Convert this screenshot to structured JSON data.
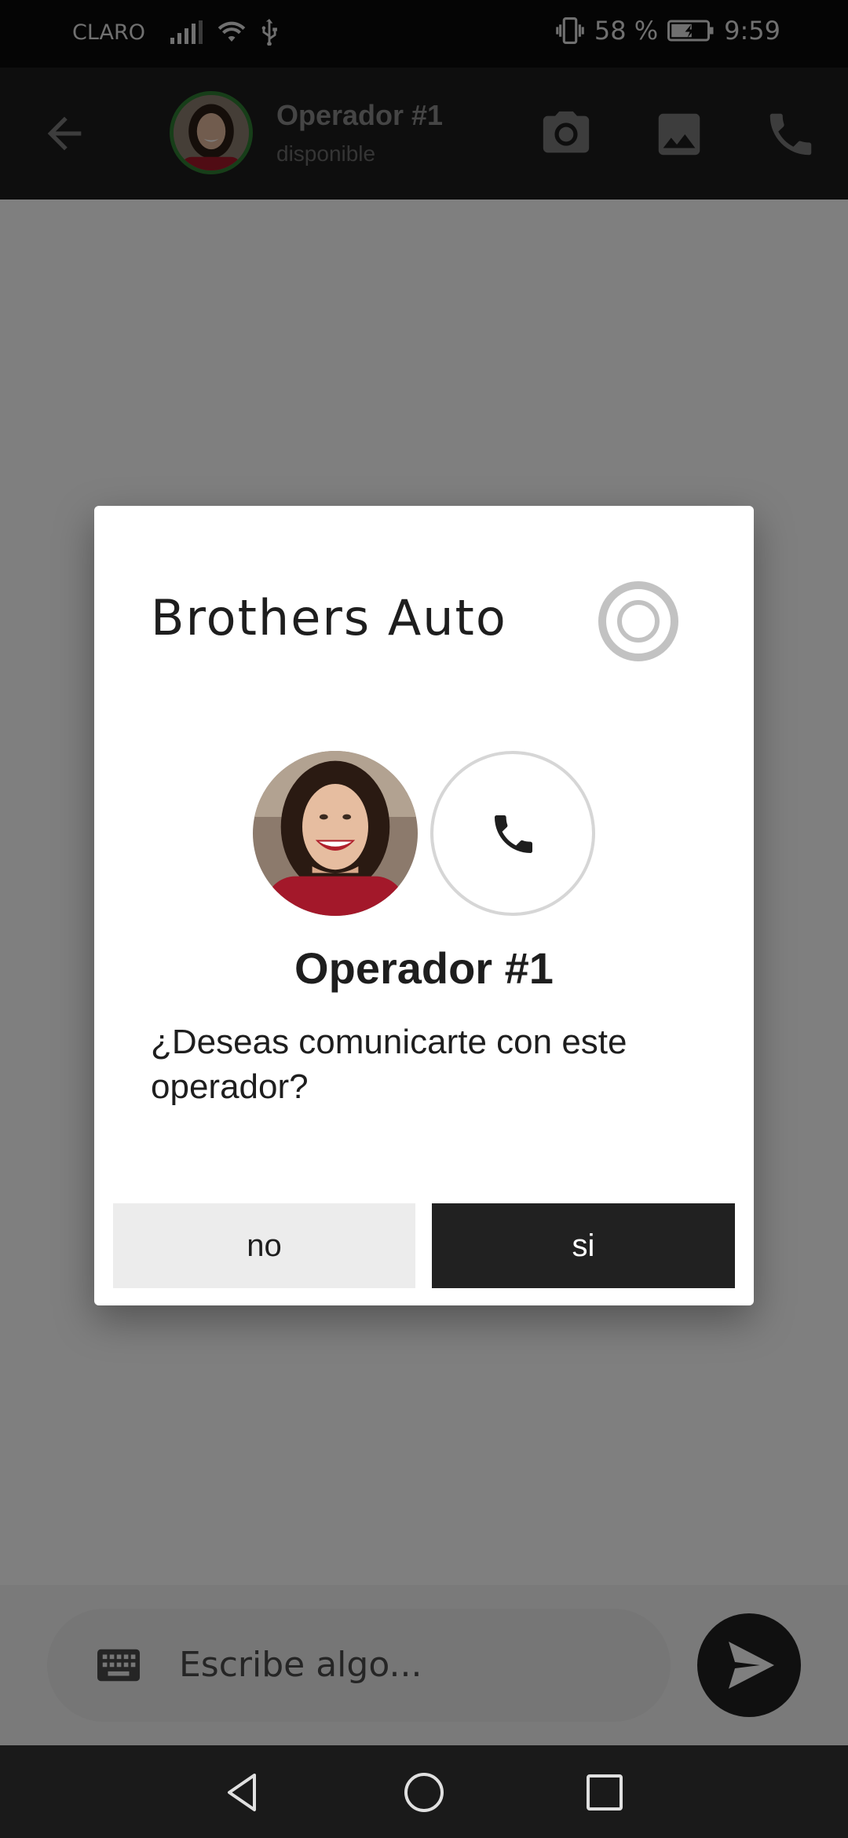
{
  "status_bar": {
    "carrier": "CLARO",
    "battery_percent": "58 %",
    "time": "9:59",
    "icons": [
      "signal-icon",
      "wifi-icon",
      "usb-icon",
      "vibrate-icon",
      "battery-charging-icon"
    ]
  },
  "header": {
    "contact_name": "Operador #1",
    "contact_status": "disponible",
    "icons": [
      "back-arrow-icon",
      "camera-icon",
      "image-icon",
      "phone-icon"
    ],
    "status_ring_color": "#2e7d32"
  },
  "composer": {
    "placeholder": "Escribe algo...",
    "icons": [
      "keyboard-icon",
      "send-icon"
    ]
  },
  "nav": {
    "icons": [
      "nav-back-icon",
      "nav-home-icon",
      "nav-recents-icon"
    ]
  },
  "dialog": {
    "brand": "Brothers Auto",
    "operator_name": "Operador #1",
    "question": "¿Deseas comunicarte con este operador?",
    "no_label": "no",
    "yes_label": "si",
    "icons": [
      "loading-spinner-icon",
      "operator-photo",
      "phone-call-icon"
    ]
  },
  "colors": {
    "primary_dark": "#212121",
    "light_button": "#ececec",
    "scrim": "rgba(0,0,0,0.5)"
  }
}
